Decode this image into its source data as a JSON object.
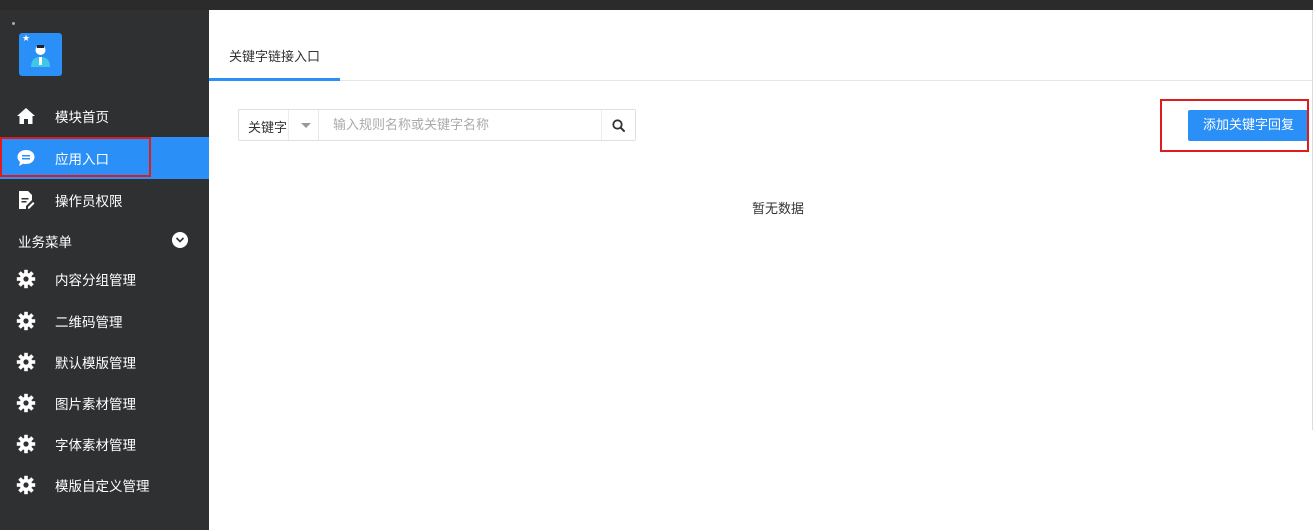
{
  "sidebar": {
    "items": [
      {
        "label": "模块首页",
        "icon": "home-icon"
      },
      {
        "label": "应用入口",
        "icon": "chat-bubble-icon",
        "active": true
      },
      {
        "label": "操作员权限",
        "icon": "document-edit-icon"
      }
    ],
    "group": {
      "label": "业务菜单",
      "toggle_icon": "chevron-down-circle-icon",
      "items": [
        {
          "label": "内容分组管理",
          "icon": "gear-icon"
        },
        {
          "label": "二维码管理",
          "icon": "gear-icon"
        },
        {
          "label": "默认模版管理",
          "icon": "gear-icon"
        },
        {
          "label": "图片素材管理",
          "icon": "gear-icon"
        },
        {
          "label": "字体素材管理",
          "icon": "gear-icon"
        },
        {
          "label": "模版自定义管理",
          "icon": "gear-icon"
        }
      ]
    }
  },
  "main": {
    "tabs": [
      {
        "label": "关键字链接入口",
        "active": true
      }
    ],
    "search": {
      "select_value": "关键字",
      "placeholder": "输入规则名称或关键字名称",
      "search_icon": "search-icon"
    },
    "add_button_label": "添加关键字回复",
    "empty_text": "暂无数据"
  },
  "colors": {
    "sidebar_bg": "#2f3032",
    "accent": "#2a8ff7",
    "highlight": "#e01b1b"
  }
}
